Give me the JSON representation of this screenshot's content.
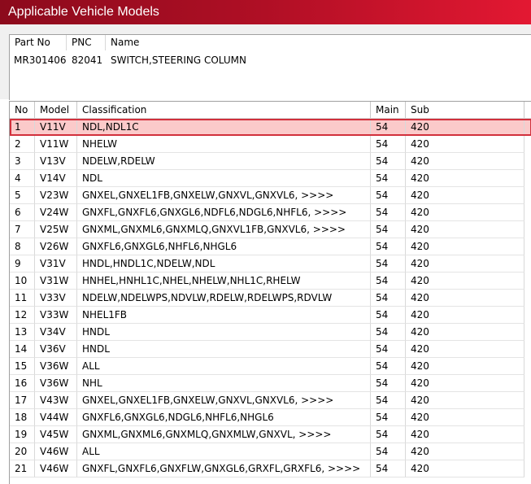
{
  "window": {
    "title": "Applicable Vehicle Models"
  },
  "part": {
    "headers": {
      "part_no": "Part No",
      "pnc": "PNC",
      "name": "Name"
    },
    "part_no": "MR301406",
    "pnc": "82041",
    "name": "SWITCH,STEERING COLUMN"
  },
  "table": {
    "headers": {
      "no": "No",
      "model": "Model",
      "classification": "Classification",
      "main": "Main",
      "sub": "Sub"
    },
    "selected_index": 0,
    "rows": [
      {
        "no": "1",
        "model": "V11V",
        "classification": "NDL,NDL1C",
        "main": "54",
        "sub": "420"
      },
      {
        "no": "2",
        "model": "V11W",
        "classification": "NHELW",
        "main": "54",
        "sub": "420"
      },
      {
        "no": "3",
        "model": "V13V",
        "classification": "NDELW,RDELW",
        "main": "54",
        "sub": "420"
      },
      {
        "no": "4",
        "model": "V14V",
        "classification": "NDL",
        "main": "54",
        "sub": "420"
      },
      {
        "no": "5",
        "model": "V23W",
        "classification": "GNXEL,GNXEL1FB,GNXELW,GNXVL,GNXVL6,  >>>>",
        "main": "54",
        "sub": "420"
      },
      {
        "no": "6",
        "model": "V24W",
        "classification": "GNXFL,GNXFL6,GNXGL6,NDFL6,NDGL6,NHFL6,  >>>>",
        "main": "54",
        "sub": "420"
      },
      {
        "no": "7",
        "model": "V25W",
        "classification": "GNXML,GNXML6,GNXMLQ,GNXVL1FB,GNXVL6,  >>>>",
        "main": "54",
        "sub": "420"
      },
      {
        "no": "8",
        "model": "V26W",
        "classification": "GNXFL6,GNXGL6,NHFL6,NHGL6",
        "main": "54",
        "sub": "420"
      },
      {
        "no": "9",
        "model": "V31V",
        "classification": "HNDL,HNDL1C,NDELW,NDL",
        "main": "54",
        "sub": "420"
      },
      {
        "no": "10",
        "model": "V31W",
        "classification": "HNHEL,HNHL1C,NHEL,NHELW,NHL1C,RHELW",
        "main": "54",
        "sub": "420"
      },
      {
        "no": "11",
        "model": "V33V",
        "classification": "NDELW,NDELWPS,NDVLW,RDELW,RDELWPS,RDVLW",
        "main": "54",
        "sub": "420"
      },
      {
        "no": "12",
        "model": "V33W",
        "classification": "NHEL1FB",
        "main": "54",
        "sub": "420"
      },
      {
        "no": "13",
        "model": "V34V",
        "classification": "HNDL",
        "main": "54",
        "sub": "420"
      },
      {
        "no": "14",
        "model": "V36V",
        "classification": "HNDL",
        "main": "54",
        "sub": "420"
      },
      {
        "no": "15",
        "model": "V36W",
        "classification": "ALL",
        "main": "54",
        "sub": "420"
      },
      {
        "no": "16",
        "model": "V36W",
        "classification": "NHL",
        "main": "54",
        "sub": "420"
      },
      {
        "no": "17",
        "model": "V43W",
        "classification": "GNXEL,GNXEL1FB,GNXELW,GNXVL,GNXVL6,  >>>>",
        "main": "54",
        "sub": "420"
      },
      {
        "no": "18",
        "model": "V44W",
        "classification": "GNXFL6,GNXGL6,NDGL6,NHFL6,NHGL6",
        "main": "54",
        "sub": "420"
      },
      {
        "no": "19",
        "model": "V45W",
        "classification": "GNXML,GNXML6,GNXMLQ,GNXMLW,GNXVL,  >>>>",
        "main": "54",
        "sub": "420"
      },
      {
        "no": "20",
        "model": "V46W",
        "classification": "ALL",
        "main": "54",
        "sub": "420"
      },
      {
        "no": "21",
        "model": "V46W",
        "classification": "GNXFL,GNXFL6,GNXFLW,GNXGL6,GRXFL,GRXFL6,  >>>>",
        "main": "54",
        "sub": "420"
      }
    ]
  },
  "colors": {
    "title_gradient_start": "#8c0a1c",
    "title_gradient_end": "#e31832",
    "selected_row_fill": "#fbcaca",
    "selected_row_border": "#d2303c"
  }
}
